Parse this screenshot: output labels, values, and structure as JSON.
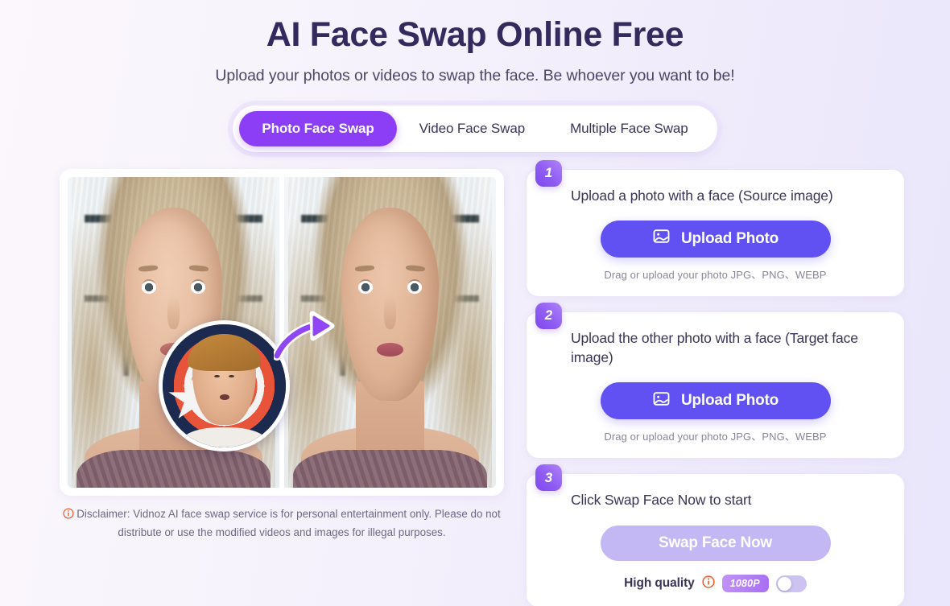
{
  "header": {
    "title": "AI Face Swap Online Free",
    "subtitle": "Upload your photos or videos to swap the face. Be whoever you want to be!"
  },
  "tabs": [
    {
      "label": "Photo Face Swap",
      "active": true
    },
    {
      "label": "Video Face Swap",
      "active": false
    },
    {
      "label": "Multiple Face Swap",
      "active": false
    }
  ],
  "preview": {
    "before_alt": "Woman with long blonde braided hair, original face",
    "after_alt": "Woman with long blonde braided hair, swapped face",
    "source_face_alt": "Man in front of a red white and blue star shield",
    "arrow_alt": "curved purple arrow pointing from source to result",
    "disclaimer": "Disclaimer: Vidnoz AI face swap service is for personal entertainment only. Please do not distribute or use the modified videos and images for illegal purposes."
  },
  "steps": [
    {
      "number": "1",
      "title": "Upload a photo with a face (Source image)",
      "button_label": "Upload Photo",
      "hint": "Drag or upload your photo JPG、PNG、WEBP"
    },
    {
      "number": "2",
      "title": "Upload the other photo with a face (Target face image)",
      "button_label": "Upload Photo",
      "hint": "Drag or upload your photo JPG、PNG、WEBP"
    },
    {
      "number": "3",
      "title": "Click Swap Face Now to start",
      "button_label": "Swap Face Now",
      "quality_label": "High quality",
      "resolution_badge": "1080P",
      "toggle_state": "off"
    }
  ],
  "colors": {
    "accent_purple": "#8b3ef5",
    "button_indigo": "#6150f2",
    "disabled_button": "#c3b8f4",
    "title_dark": "#342a5e",
    "info_orange": "#f05a28",
    "toggle_track": "#cdc3f2",
    "bg_left": "#fbf7fc",
    "bg_right": "#eae6fb"
  }
}
